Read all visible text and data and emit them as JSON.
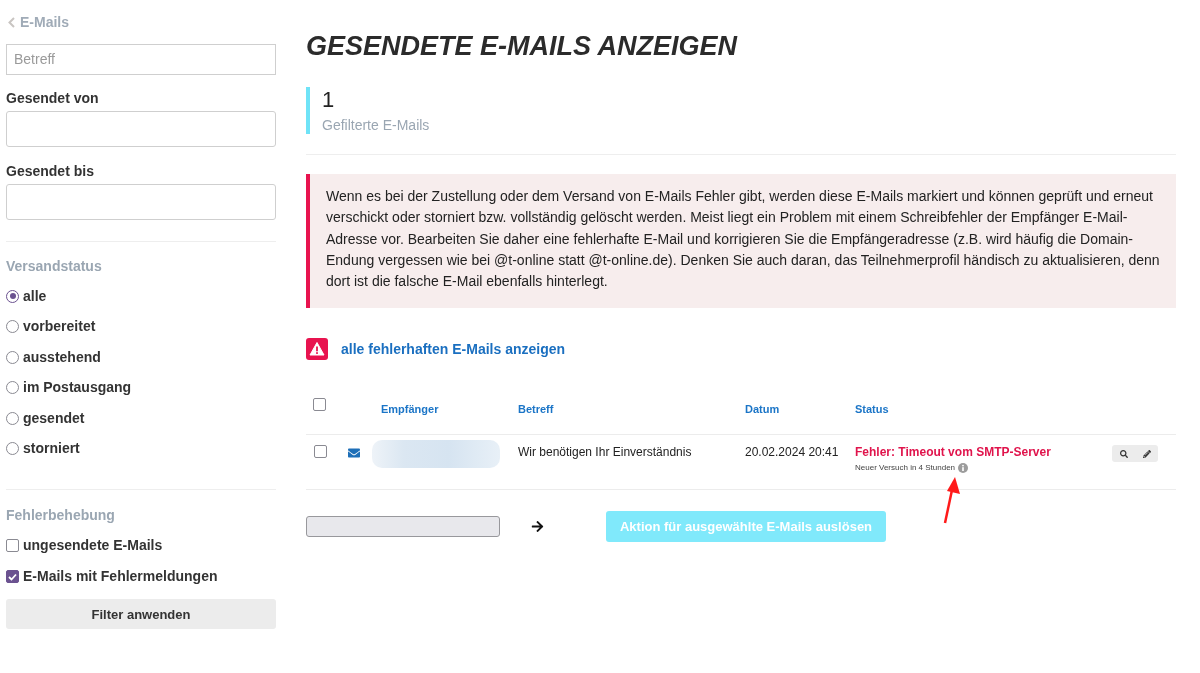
{
  "sidebar": {
    "back_link": "E-Mails",
    "subject_field": {
      "placeholder": "Betreff"
    },
    "sent_from": {
      "label": "Gesendet von"
    },
    "sent_until": {
      "label": "Gesendet bis"
    },
    "shipping_status": {
      "heading": "Versandstatus",
      "options": [
        {
          "label": "alle",
          "selected": true
        },
        {
          "label": "vorbereitet",
          "selected": false
        },
        {
          "label": "ausstehend",
          "selected": false
        },
        {
          "label": "im Postausgang",
          "selected": false
        },
        {
          "label": "gesendet",
          "selected": false
        },
        {
          "label": "storniert",
          "selected": false
        }
      ]
    },
    "troubleshooting": {
      "heading": "Fehlerbehebung",
      "options": [
        {
          "label": "ungesendete E-Mails",
          "checked": false
        },
        {
          "label": "E-Mails mit Fehlermeldungen",
          "checked": true
        }
      ]
    },
    "apply_button": "Filter anwenden"
  },
  "main": {
    "title": "GESENDETE E-MAILS ANZEIGEN",
    "stat": {
      "value": "1",
      "label": "Gefilterte E-Mails"
    },
    "alert": "Wenn es bei der Zustellung oder dem Versand von E-Mails Fehler gibt, werden diese E-Mails markiert und können geprüft und erneut verschickt oder storniert bzw. vollständig gelöscht werden. Meist liegt ein Problem mit einem Schreibfehler der Empfänger E-Mail-Adresse vor. Bearbeiten Sie daher eine fehlerhafte E-Mail und korrigieren Sie die Empfängeradresse (z.B. wird häufig die Domain-Endung vergessen wie bei @t-online statt @t-online.de). Denken Sie auch daran, das Teilnehmerprofil händisch zu aktualisieren, denn dort ist die falsche E-Mail ebenfalls hinterlegt.",
    "error_link": "alle fehlerhaften E-Mails anzeigen",
    "table": {
      "select_all_checked": false,
      "columns": [
        "Empfänger",
        "Betreff",
        "Datum",
        "Status"
      ],
      "rows": [
        {
          "kind": "error",
          "checked": false,
          "recipient_redacted": true,
          "subject": "Wir benötigen Ihr Einverständnis",
          "date": "20.02.2024 20:41",
          "status": "Fehler: Timeout vom SMTP-Server",
          "retry_note": "Neuer Versuch in 4 Stunden"
        }
      ]
    },
    "bulk_action": {
      "button": "Aktion für ausgewählte E-Mails auslösen",
      "disabled": true
    }
  }
}
